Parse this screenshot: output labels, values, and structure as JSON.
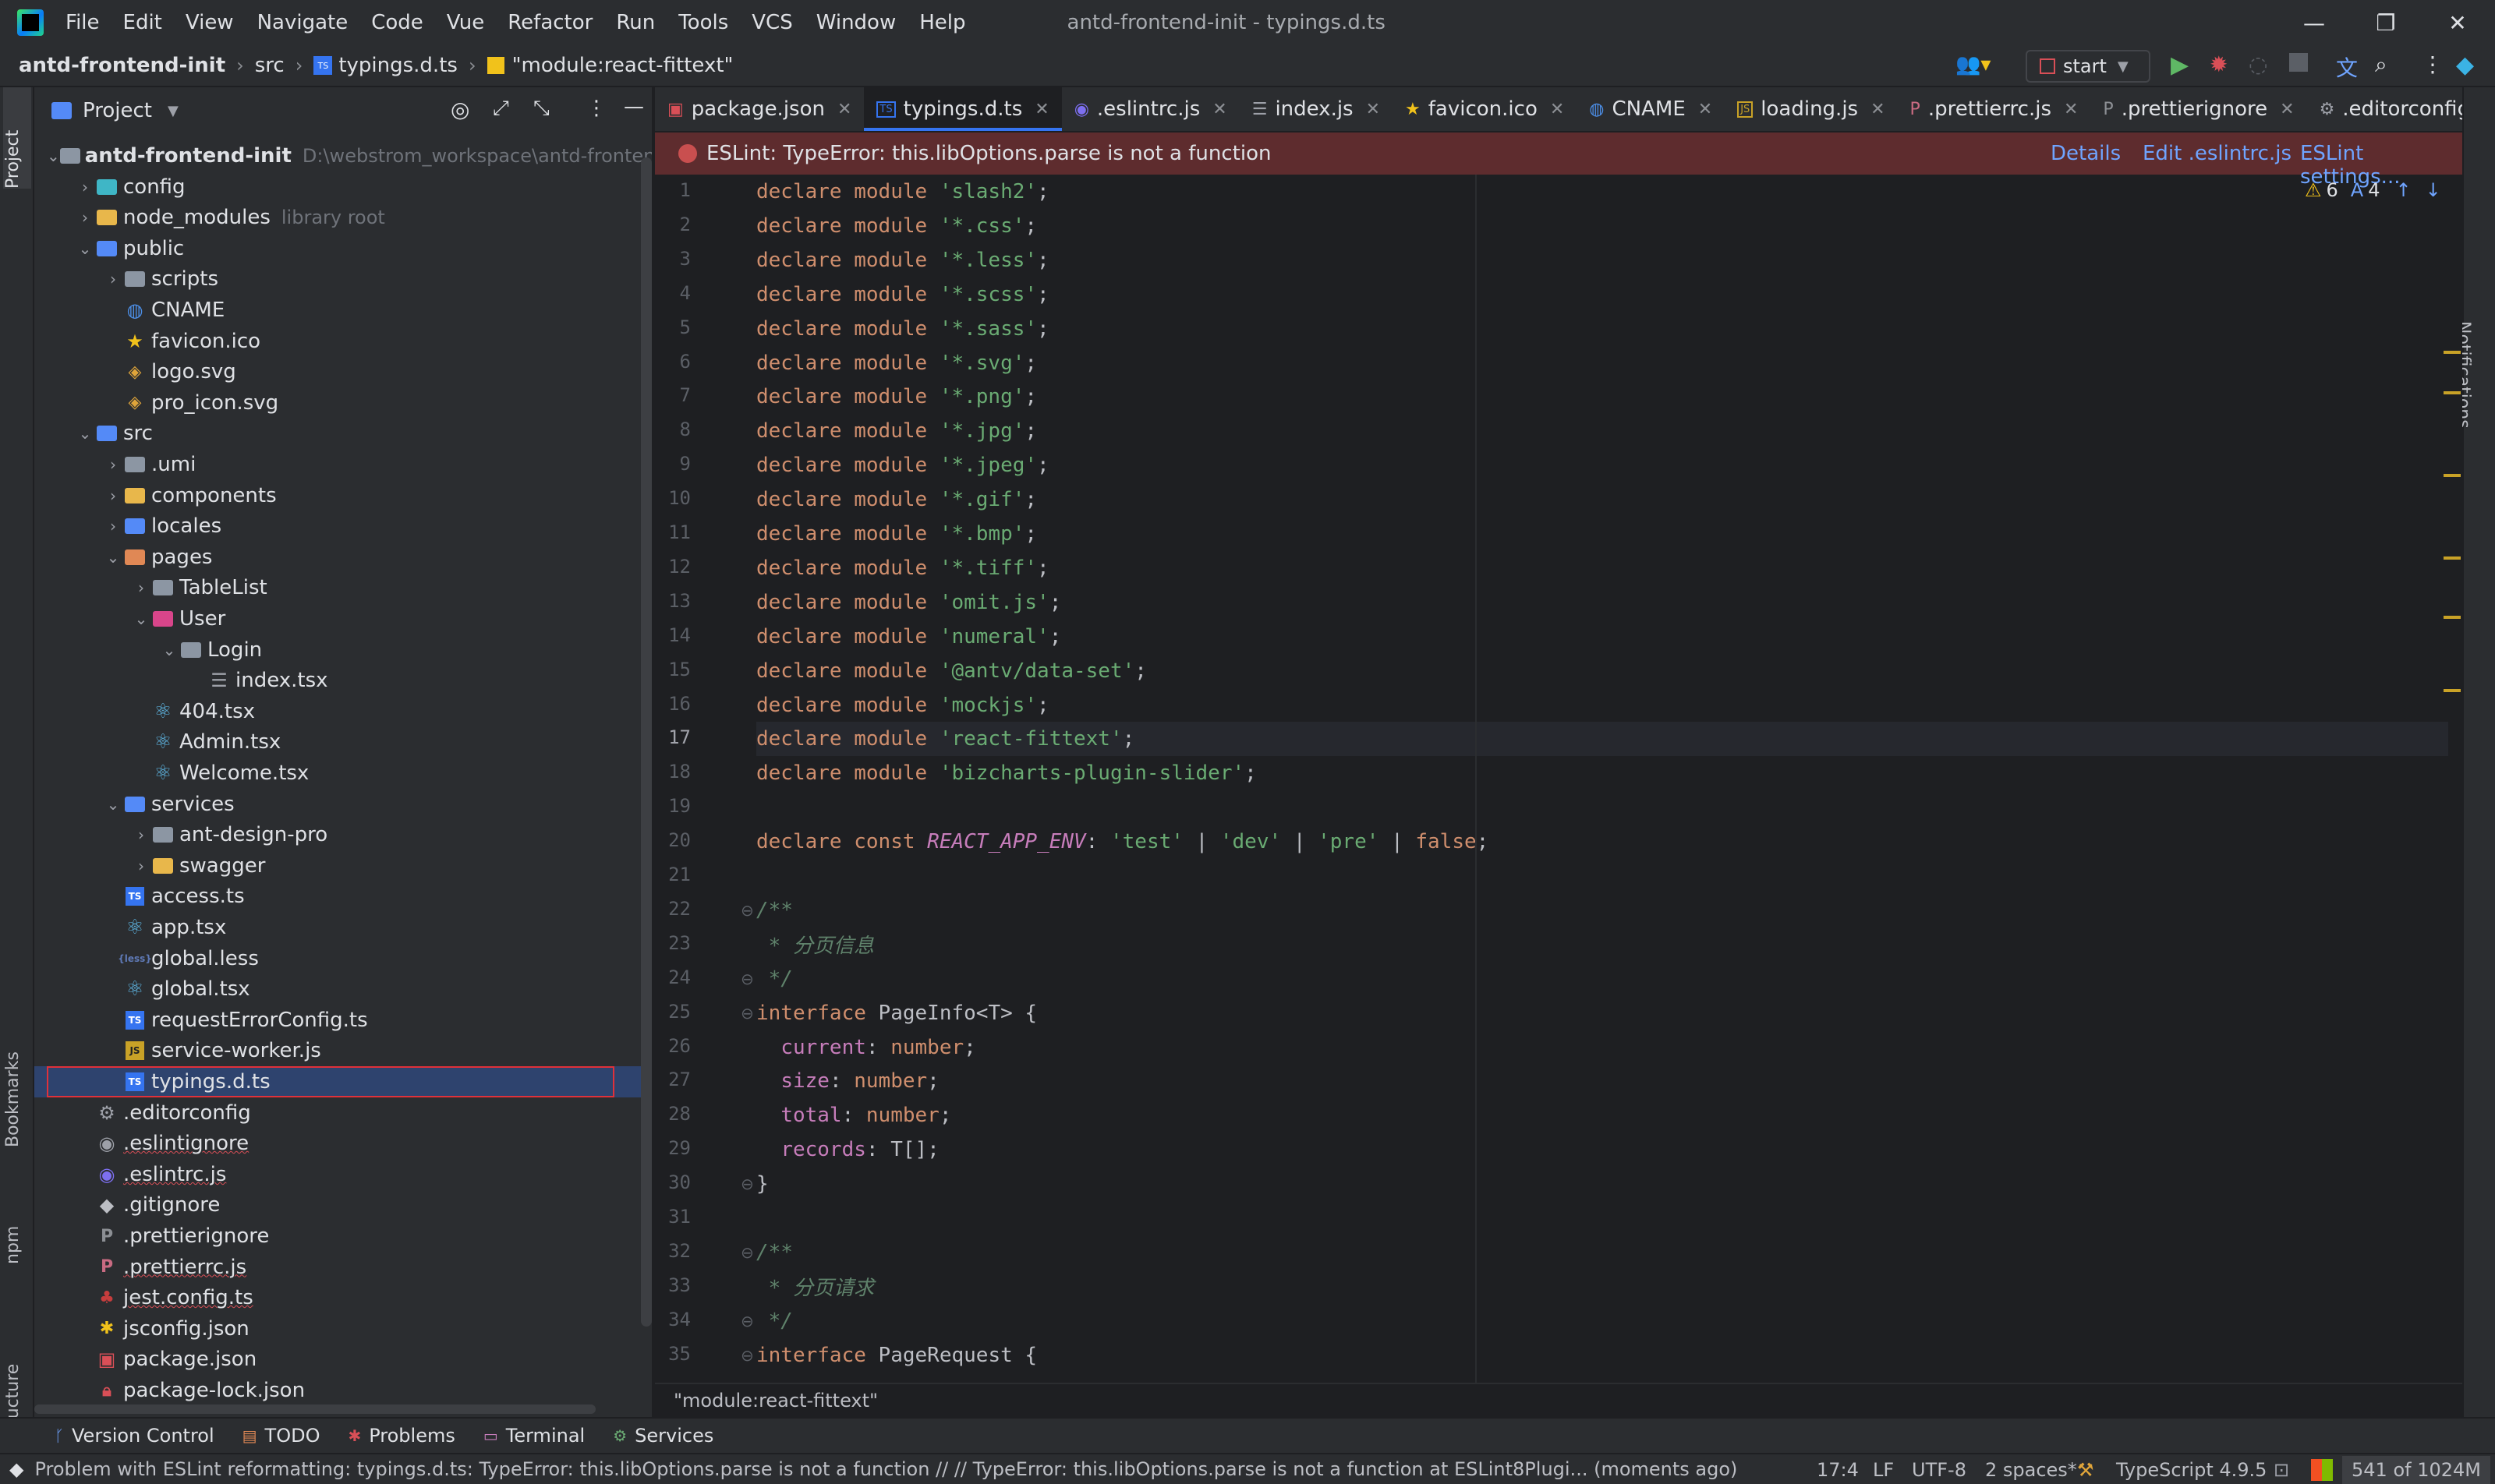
{
  "menubar": {
    "items": [
      "File",
      "Edit",
      "View",
      "Navigate",
      "Code",
      "Vue",
      "Refactor",
      "Run",
      "Tools",
      "VCS",
      "Window",
      "Help"
    ],
    "window_title": "antd-frontend-init - typings.d.ts"
  },
  "navbar": {
    "project": "antd-frontend-init",
    "folder": "src",
    "file": "typings.d.ts",
    "symbol": "\"module:react-fittext\"",
    "run_config": "start"
  },
  "left_strip": {
    "project": "Project",
    "bookmarks": "Bookmarks",
    "npm": "npm",
    "structure": "Structure"
  },
  "right_strip": {
    "notifications": "Notifications"
  },
  "project_panel": {
    "title": "Project",
    "tree": [
      {
        "label": "antd-frontend-init",
        "hint": "D:\\webstrom_workspace\\antd-frontend-i",
        "icon": "folder",
        "chev": "down",
        "bold": true
      },
      {
        "label": "config",
        "icon": "folder-teal",
        "chev": "right"
      },
      {
        "label": "node_modules",
        "hint": "library root",
        "icon": "folder-yellow",
        "chev": "right"
      },
      {
        "label": "public",
        "icon": "folder-blue",
        "chev": "down"
      },
      {
        "label": "scripts",
        "icon": "folder",
        "chev": "right"
      },
      {
        "label": "CNAME",
        "icon": "globe"
      },
      {
        "label": "favicon.ico",
        "icon": "star"
      },
      {
        "label": "logo.svg",
        "icon": "svg"
      },
      {
        "label": "pro_icon.svg",
        "icon": "svg"
      },
      {
        "label": "src",
        "icon": "folder-blue",
        "chev": "down"
      },
      {
        "label": ".umi",
        "icon": "folder",
        "chev": "right"
      },
      {
        "label": "components",
        "icon": "folder-yellow",
        "chev": "right"
      },
      {
        "label": "locales",
        "icon": "folder-blue",
        "chev": "right"
      },
      {
        "label": "pages",
        "icon": "folder-orange",
        "chev": "down"
      },
      {
        "label": "TableList",
        "icon": "folder",
        "chev": "right"
      },
      {
        "label": "User",
        "icon": "folder-pink",
        "chev": "down"
      },
      {
        "label": "Login",
        "icon": "folder",
        "chev": "down"
      },
      {
        "label": "index.tsx",
        "icon": "tsx-list"
      },
      {
        "label": "404.tsx",
        "icon": "react"
      },
      {
        "label": "Admin.tsx",
        "icon": "react"
      },
      {
        "label": "Welcome.tsx",
        "icon": "react"
      },
      {
        "label": "services",
        "icon": "folder-blue",
        "chev": "down"
      },
      {
        "label": "ant-design-pro",
        "icon": "folder",
        "chev": "right"
      },
      {
        "label": "swagger",
        "icon": "folder-yellow",
        "chev": "right"
      },
      {
        "label": "access.ts",
        "icon": "ts"
      },
      {
        "label": "app.tsx",
        "icon": "react"
      },
      {
        "label": "global.less",
        "icon": "less"
      },
      {
        "label": "global.tsx",
        "icon": "react"
      },
      {
        "label": "requestErrorConfig.ts",
        "icon": "ts"
      },
      {
        "label": "service-worker.js",
        "icon": "js"
      },
      {
        "label": "typings.d.ts",
        "icon": "ts",
        "selected": true
      },
      {
        "label": ".editorconfig",
        "icon": "cfg"
      },
      {
        "label": ".eslintignore",
        "icon": "cfg-circle"
      },
      {
        "label": ".eslintrc.js",
        "icon": "eslint"
      },
      {
        "label": ".gitignore",
        "icon": "git"
      },
      {
        "label": ".prettierignore",
        "icon": "prettier-dim"
      },
      {
        "label": ".prettierrc.js",
        "icon": "prettier"
      },
      {
        "label": "jest.config.ts",
        "icon": "jest"
      },
      {
        "label": "jsconfig.json",
        "icon": "json"
      },
      {
        "label": "package.json",
        "icon": "pkg"
      },
      {
        "label": "package-lock.json",
        "icon": "lock"
      }
    ]
  },
  "tabs": [
    {
      "label": "package.json",
      "icon": "▣",
      "color": "#d94f57"
    },
    {
      "label": "typings.d.ts",
      "icon": "TS",
      "color": "#3574f0",
      "active": true
    },
    {
      "label": ".eslintrc.js",
      "icon": "◉",
      "color": "#7d6ff0"
    },
    {
      "label": "index.js",
      "icon": "☰",
      "color": "#9da0a8"
    },
    {
      "label": "favicon.ico",
      "icon": "★",
      "color": "#f1c21b"
    },
    {
      "label": "CNAME",
      "icon": "◍",
      "color": "#4c8fe8"
    },
    {
      "label": "loading.js",
      "icon": "JS",
      "color": "#c9a227"
    },
    {
      "label": ".prettierrc.js",
      "icon": "P",
      "color": "#c96b82"
    },
    {
      "label": ".prettierignore",
      "icon": "P",
      "color": "#8c8f94"
    },
    {
      "label": ".editorconfig",
      "icon": "⚙",
      "color": "#9da0a8"
    }
  ],
  "eslint_banner": {
    "message": "ESLint: TypeError: this.libOptions.parse is not a function",
    "details": "Details",
    "edit": "Edit .eslintrc.js",
    "settings": "ESLint settings..."
  },
  "inspections": {
    "warnings": "6",
    "typos": "4"
  },
  "code_lines": [
    "declare module 'slash2';",
    "declare module '*.css';",
    "declare module '*.less';",
    "declare module '*.scss';",
    "declare module '*.sass';",
    "declare module '*.svg';",
    "declare module '*.png';",
    "declare module '*.jpg';",
    "declare module '*.jpeg';",
    "declare module '*.gif';",
    "declare module '*.bmp';",
    "declare module '*.tiff';",
    "declare module 'omit.js';",
    "declare module 'numeral';",
    "declare module '@antv/data-set';",
    "declare module 'mockjs';",
    "declare module 'react-fittext';",
    "declare module 'bizcharts-plugin-slider';",
    "",
    "declare const REACT_APP_ENV: 'test' | 'dev' | 'pre' | false;",
    "",
    "/**",
    " * 分页信息",
    " */",
    "interface PageInfo<T> {",
    "  current: number;",
    "  size: number;",
    "  total: number;",
    "  records: T[];",
    "}",
    "",
    "/**",
    " * 分页请求",
    " */",
    "interface PageRequest {"
  ],
  "current_line": 17,
  "editor_footer": "\"module:react-fittext\"",
  "bottom_tools": [
    {
      "label": "Version Control",
      "icon": "ᚴ",
      "color": "#6fa4ff"
    },
    {
      "label": "TODO",
      "icon": "▤",
      "color": "#e08855"
    },
    {
      "label": "Problems",
      "icon": "✱",
      "color": "#d94f57"
    },
    {
      "label": "Terminal",
      "icon": "▭",
      "color": "#c77dbb"
    },
    {
      "label": "Services",
      "icon": "⚙",
      "color": "#6aab73"
    }
  ],
  "status": {
    "message": "Problem with ESLint reformatting: typings.d.ts: TypeError: this.libOptions.parse is not a function // // TypeError: this.libOptions.parse is not a function    at ESLint8Plugi... (moments ago)",
    "position": "17:4",
    "line_sep": "LF",
    "encoding": "UTF-8",
    "indent": "2 spaces*",
    "language": "TypeScript 4.9.5",
    "memory": "541 of 1024M"
  }
}
